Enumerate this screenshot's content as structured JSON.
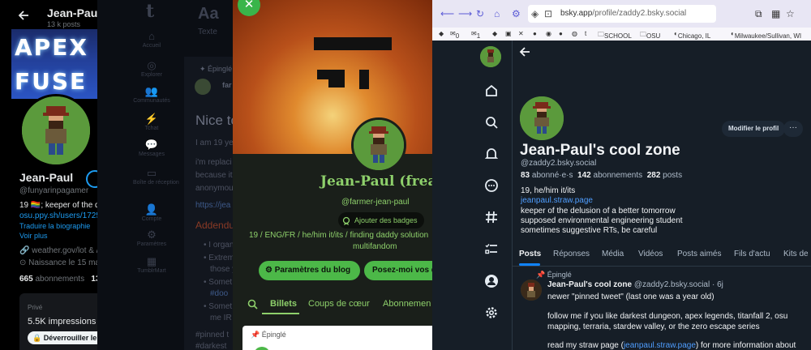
{
  "x_profile": {
    "header_name": "Jean-Paul",
    "header_posts": "13 k posts",
    "banner_line1": "APEX",
    "banner_line2": "FUSE",
    "display_name": "Jean-Paul",
    "handle": "@funyarinpagamer",
    "bio": "19 🏳️‍🌈; keeper of the de",
    "link": "osu.ppy.sh/users/1725",
    "translate": "Traduire la biographie",
    "see_more": "Voir plus",
    "website": "weather.gov/lot & /",
    "birth": "Naissance le 15 ma",
    "following_count": "665",
    "following_label": "abonnements",
    "followers_count": "13",
    "card_label": "Privé",
    "impressions": "5.5K impressions su",
    "unlock_label": "Déverrouiller le"
  },
  "tumblr_dark": {
    "logo": "t",
    "nav": [
      {
        "label": "Accueil"
      },
      {
        "label": "Explorer"
      },
      {
        "label": "Communautés"
      },
      {
        "label": "Tchat"
      },
      {
        "label": "Messages"
      },
      {
        "label": "Boîte de réception"
      },
      {
        "label": "Compte"
      },
      {
        "label": "Paramètres"
      },
      {
        "label": "TumblrMart"
      }
    ],
    "compose_icon": "Aa",
    "compose_label": "Texte",
    "pinned": "Épinglé",
    "author": "far",
    "post_title": "Nice to",
    "line1": "I am 19 yea",
    "line2": "i'm replaci",
    "line3": "because it",
    "line4": "anonymou",
    "line5_link": "https://jea",
    "addendum": "Addendu",
    "bullets": [
      "I organ",
      "Extrem",
      "those y",
      "Somet",
      "#doo",
      "Somet",
      "me IR"
    ],
    "tags1": "#pinned t",
    "tags2": "#darkest"
  },
  "tumblr_blog": {
    "blog_title": "Jean-Paul (freak)",
    "blog_handle": "@farmer-jean-paul",
    "badges_label": "Ajouter des badges",
    "description_line1": "19 / ENG/FR / he/him it/its / finding daddy solution",
    "description_line2": "multifandom",
    "settings_button": "Paramètres du blog",
    "ask_button": "Posez-moi vos q",
    "tabs": [
      "Billets",
      "Coups de cœur",
      "Abonnemen"
    ],
    "pinned": "Épinglé"
  },
  "browser": {
    "url_host": "bsky.app",
    "url_path": "/profile/zaddy2.bsky.social",
    "bookmarks": [
      "0",
      "1",
      "SCHOOL",
      "OSU",
      "Chicago, IL",
      "Milwaukee/Sullivan, WI"
    ],
    "bluesky": {
      "edit_profile": "Modifier le profil",
      "more": "···",
      "display_name": "Jean-Paul's cool zone",
      "handle": "@zaddy2.bsky.social",
      "followers_count": "83",
      "followers_label": "abonné·e·s",
      "following_count": "142",
      "following_label": "abonnements",
      "posts_count": "282",
      "posts_label": "posts",
      "bio_line1": "19, he/him it/its",
      "bio_link": "jeanpaul.straw.page",
      "bio_line2": "keeper of the delusion of a better tomorrow",
      "bio_line3": "supposed environmental engineering student",
      "bio_line4": "sometimes suggestive RTs, be careful",
      "tabs": [
        "Posts",
        "Réponses",
        "Média",
        "Vidéos",
        "Posts aimés",
        "Fils d'actu",
        "Kits de"
      ],
      "feed_pinned": "Épinglé",
      "feed_author": "Jean-Paul's cool zone",
      "feed_handle_time": "@zaddy2.bsky.social · 6j",
      "feed_line1": "newer \"pinned tweet\" (last one was a year old)",
      "feed_line2": "follow me if you like darkest dungeon, apex legends, titanfall 2, osu",
      "feed_line3": "mapping, terraria, stardew valley, or the zero escape series",
      "feed_line4_a": "read my straw page (",
      "feed_line4_link": "jeanpaul.straw.page",
      "feed_line4_b": ") for more information about"
    }
  },
  "colors": {
    "x_bg": "#000000",
    "x_link": "#1d9bf0",
    "tumblr_accent": "#8ed06b",
    "tumblr_button": "#4cb848",
    "bsky_bg": "#161e27",
    "bsky_link": "#4f9eff",
    "bsky_tab_underline": "#1083fe"
  }
}
